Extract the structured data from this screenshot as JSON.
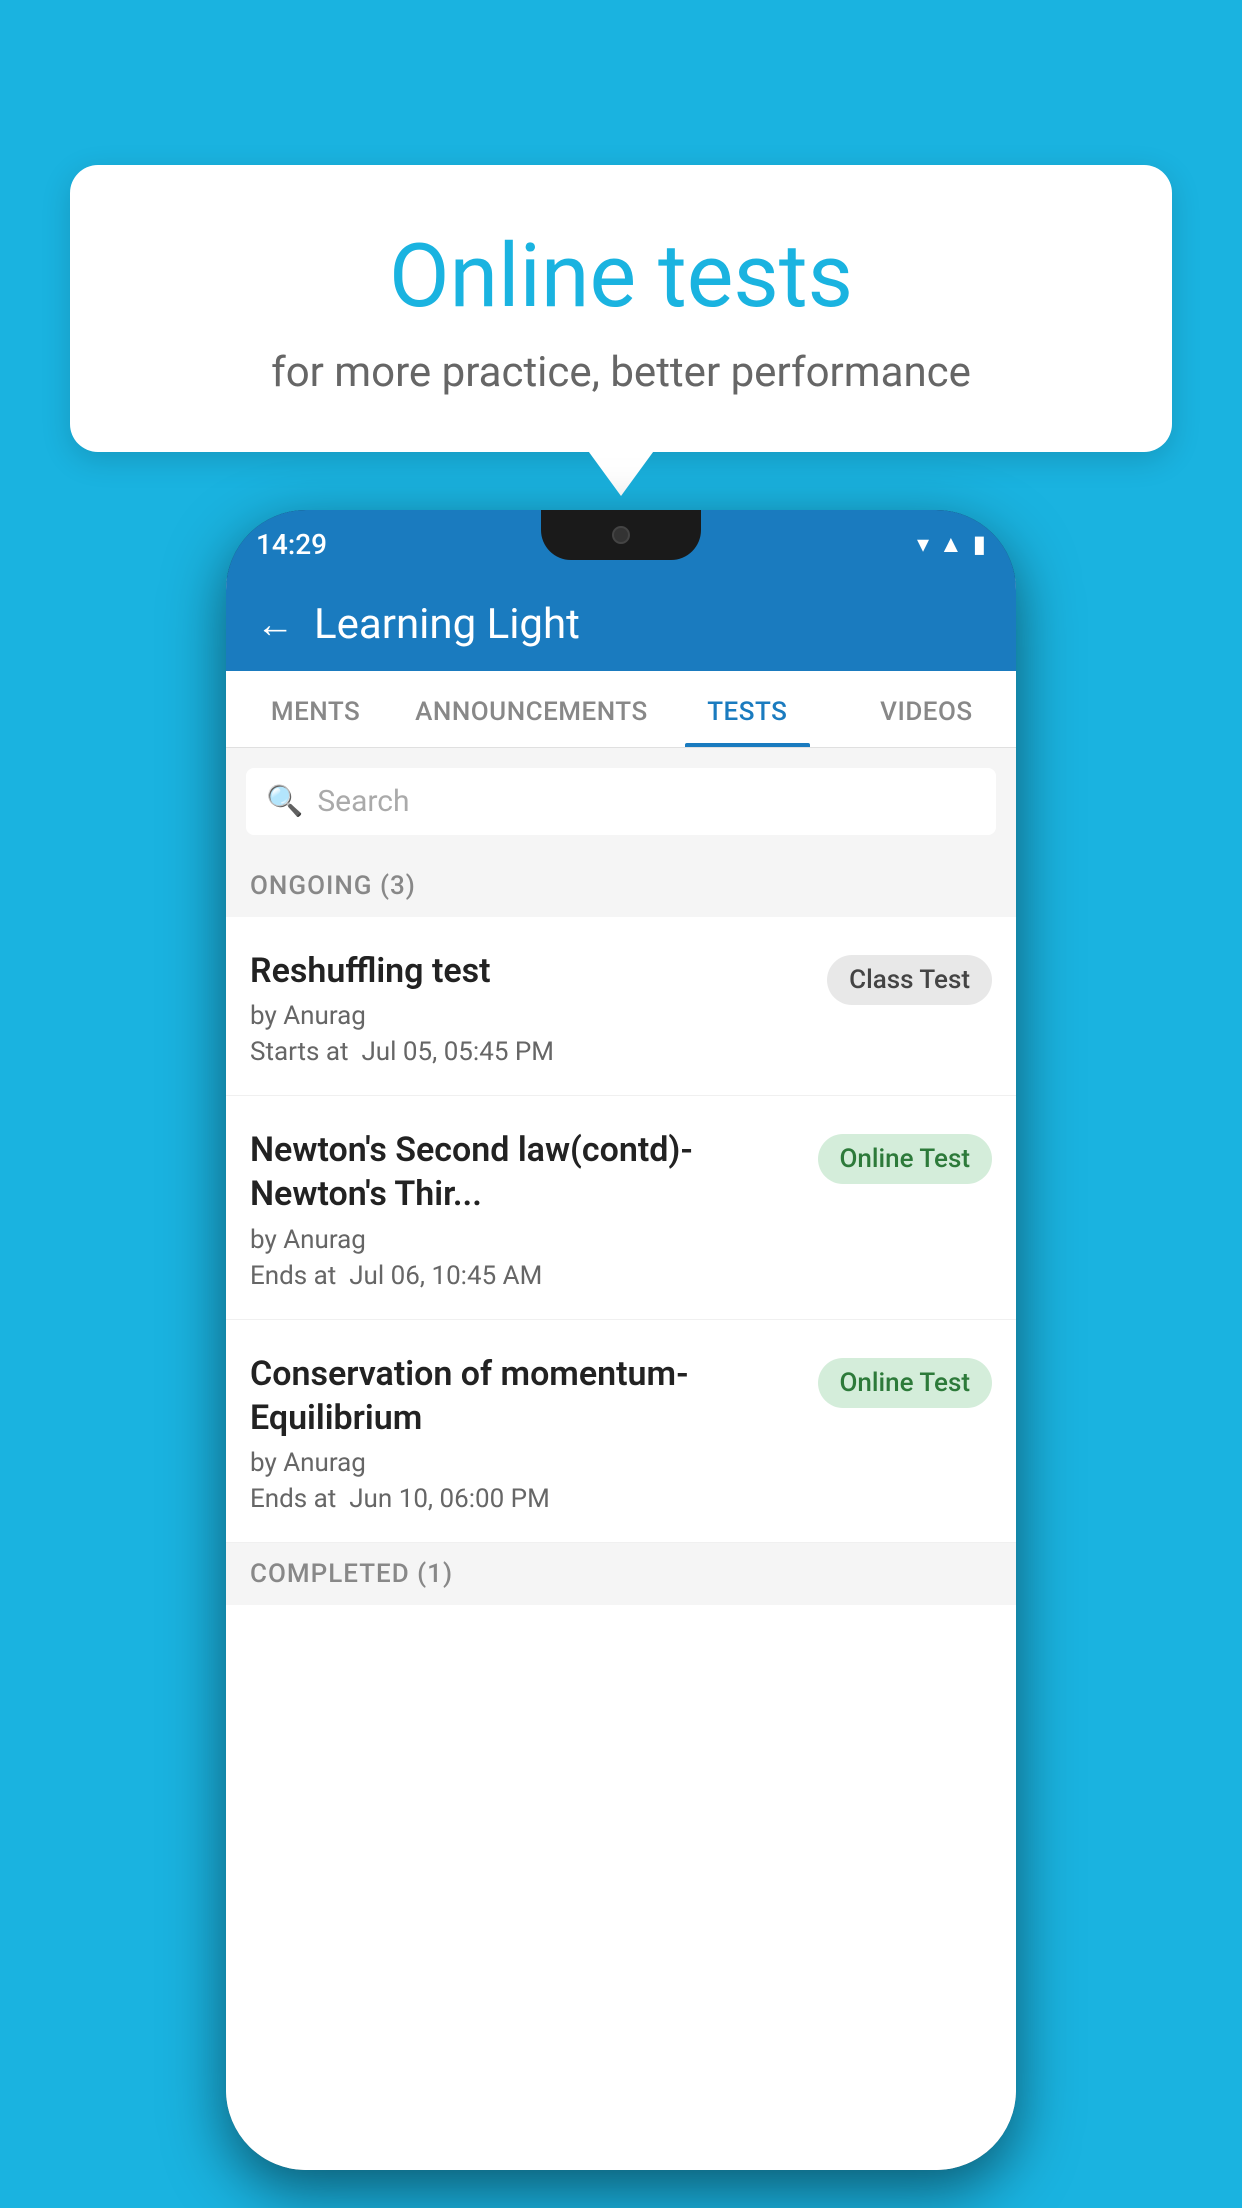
{
  "background_color": "#1ab3e0",
  "bubble": {
    "title": "Online tests",
    "subtitle": "for more practice, better performance"
  },
  "phone": {
    "status_bar": {
      "time": "14:29",
      "icons": [
        "wifi",
        "signal",
        "battery"
      ]
    },
    "header": {
      "title": "Learning Light",
      "back_label": "←"
    },
    "tabs": [
      {
        "label": "MENTS",
        "active": false
      },
      {
        "label": "ANNOUNCEMENTS",
        "active": false
      },
      {
        "label": "TESTS",
        "active": true
      },
      {
        "label": "VIDEOS",
        "active": false
      }
    ],
    "search": {
      "placeholder": "Search"
    },
    "ongoing_section": {
      "header": "ONGOING (3)",
      "tests": [
        {
          "name": "Reshuffling test",
          "author": "by Anurag",
          "time": "Starts at  Jul 05, 05:45 PM",
          "badge": "Class Test",
          "badge_type": "class"
        },
        {
          "name": "Newton's Second law(contd)-Newton's Thir...",
          "author": "by Anurag",
          "time": "Ends at  Jul 06, 10:45 AM",
          "badge": "Online Test",
          "badge_type": "online"
        },
        {
          "name": "Conservation of momentum-Equilibrium",
          "author": "by Anurag",
          "time": "Ends at  Jun 10, 06:00 PM",
          "badge": "Online Test",
          "badge_type": "online"
        }
      ]
    },
    "completed_section": {
      "header": "COMPLETED (1)"
    }
  }
}
